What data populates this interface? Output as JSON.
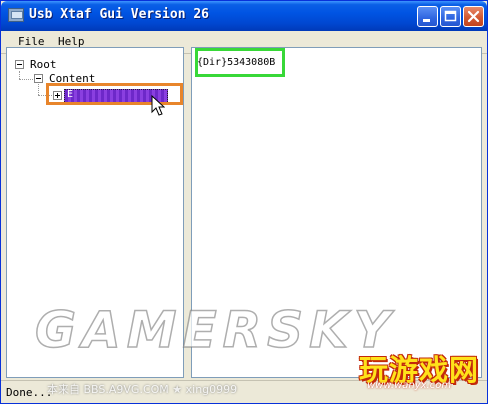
{
  "window": {
    "title": "Usb Xtaf Gui Version 26",
    "buttons": [
      "minimize",
      "maximize",
      "close"
    ]
  },
  "menu": {
    "items": [
      {
        "label": "File"
      },
      {
        "label": "Help"
      }
    ]
  },
  "tree": {
    "root_label": "Root",
    "content_label": "Content",
    "selected_node_label": "E"
  },
  "detail": {
    "entry": "{Dir}5343080B"
  },
  "status": {
    "text": "Done..."
  },
  "overlay": {
    "watermark": "GAMERSKY",
    "credit": "本来自 BBS.A9VG.COM ★ xing0999",
    "logo_cn": "玩游戏网",
    "logo_url": "www.wanyx.com",
    "highlight_orange": "#e8852b",
    "highlight_green": "#38d838"
  },
  "colors": {
    "titlebar": "#0054e3",
    "selection": "#6d28c9",
    "window_bg": "#ece9d8"
  }
}
